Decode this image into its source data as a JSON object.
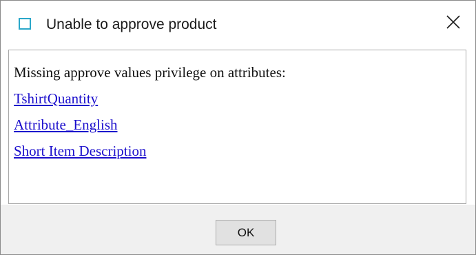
{
  "window": {
    "title": "Unable to approve product",
    "app_icon": "window-app-icon",
    "close_icon": "close-icon"
  },
  "message": {
    "heading": "Missing approve values privilege on attributes:",
    "attributes": [
      {
        "label": "TshirtQuantity"
      },
      {
        "label": "Attribute_English"
      },
      {
        "label": "Short Item Description"
      }
    ]
  },
  "footer": {
    "ok_label": "OK"
  },
  "colors": {
    "link": "#1a0dcc",
    "icon_accent": "#2aa7c9",
    "footer_bg": "#f0f0f0",
    "button_bg": "#e1e1e1"
  }
}
